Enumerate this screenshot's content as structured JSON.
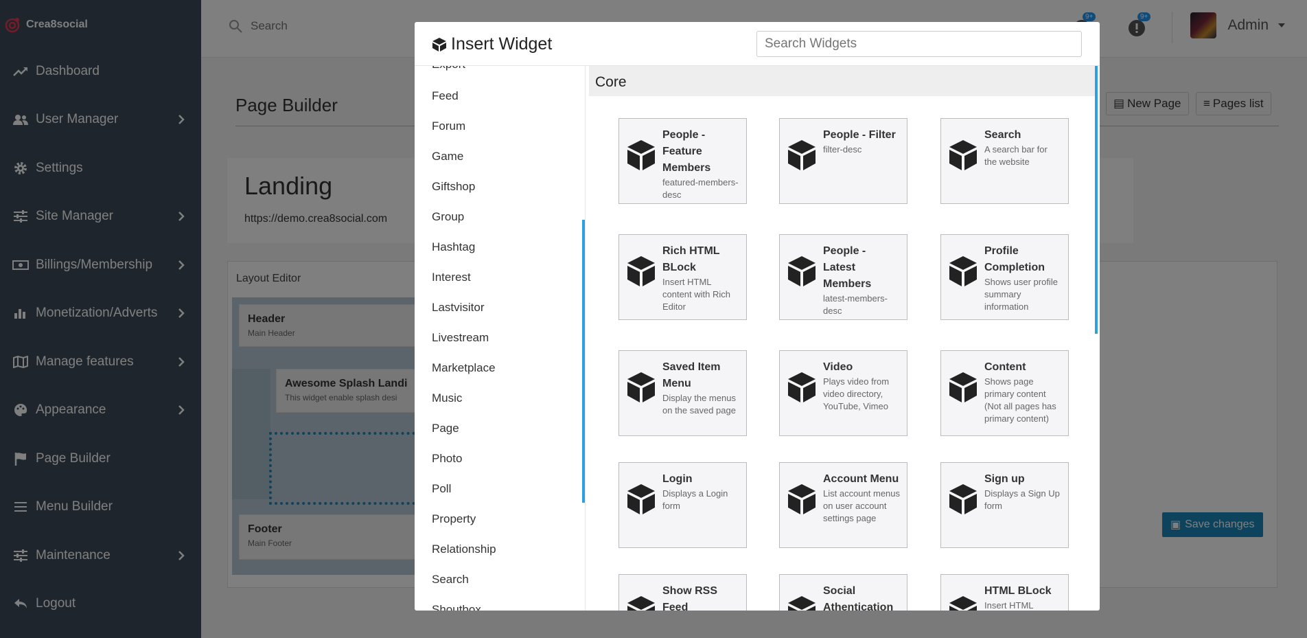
{
  "brand": {
    "name": "Crea8social"
  },
  "sidebar": {
    "items": [
      {
        "label": "Dashboard",
        "icon": "trend-icon",
        "chevron": false
      },
      {
        "label": "User Manager",
        "icon": "users-icon",
        "chevron": true
      },
      {
        "label": "Settings",
        "icon": "gear-icon",
        "chevron": false
      },
      {
        "label": "Site Manager",
        "icon": "sliders-icon",
        "chevron": true
      },
      {
        "label": "Billings/Membership",
        "icon": "money-icon",
        "chevron": true
      },
      {
        "label": "Monetization/Adverts",
        "icon": "bar-chart-icon",
        "chevron": true
      },
      {
        "label": "Manage features",
        "icon": "map-icon",
        "chevron": true
      },
      {
        "label": "Appearance",
        "icon": "palette-icon",
        "chevron": true
      },
      {
        "label": "Page Builder",
        "icon": "flag-icon",
        "chevron": false
      },
      {
        "label": "Menu Builder",
        "icon": "bars-icon",
        "chevron": false
      },
      {
        "label": "Maintenance",
        "icon": "sliders-icon",
        "chevron": true
      },
      {
        "label": "Logout",
        "icon": "reply-icon",
        "chevron": false
      }
    ]
  },
  "topbar": {
    "search_placeholder": "Search",
    "notif_badge": "9+",
    "alert_badge": "9+",
    "user": "Admin"
  },
  "page": {
    "title": "Page Builder",
    "new_page": "New Page",
    "pages_list": "Pages list",
    "landing_title": "Landing",
    "landing_url": "https://demo.crea8social.com",
    "layout_editor": "Layout Editor",
    "header_block": {
      "title": "Header",
      "sub": "Main Header"
    },
    "splash_block": {
      "title": "Awesome Splash Landi",
      "sub": "This widget enable splash desi"
    },
    "footer_block": {
      "title": "Footer",
      "sub": "Main Footer"
    },
    "save": "Save changes"
  },
  "modal": {
    "title": "Insert Widget",
    "search_placeholder": "Search Widgets",
    "categories": [
      "Export",
      "Feed",
      "Forum",
      "Game",
      "Giftshop",
      "Group",
      "Hashtag",
      "Interest",
      "Lastvisitor",
      "Livestream",
      "Marketplace",
      "Music",
      "Page",
      "Photo",
      "Poll",
      "Property",
      "Relationship",
      "Search",
      "Shoutbox"
    ],
    "section": "Core",
    "widgets": [
      {
        "title": "People - Feature Members",
        "desc": "featured-members-desc"
      },
      {
        "title": "People - Filter",
        "desc": "filter-desc"
      },
      {
        "title": "Search",
        "desc": "A search bar for the website"
      },
      {
        "title": "Rich HTML BLock",
        "desc": "Insert HTML content with Rich Editor"
      },
      {
        "title": "People - Latest Members",
        "desc": "latest-members-desc"
      },
      {
        "title": "Profile Completion",
        "desc": "Shows user profile summary information"
      },
      {
        "title": "Saved Item Menu",
        "desc": "Display the menus on the saved page"
      },
      {
        "title": "Video",
        "desc": "Plays video from video directory, YouTube, Vimeo"
      },
      {
        "title": "Content",
        "desc": "Shows page primary content (Not all pages has primary content)"
      },
      {
        "title": "Login",
        "desc": "Displays a Login form"
      },
      {
        "title": "Account Menu",
        "desc": "List account menus on user account settings page"
      },
      {
        "title": "Sign up",
        "desc": "Displays a Sign Up form"
      },
      {
        "title": "Show RSS Feed",
        "desc": ""
      },
      {
        "title": "Social Athentication",
        "desc": ""
      },
      {
        "title": "HTML BLock",
        "desc": "Insert HTML"
      }
    ]
  },
  "colors": {
    "sidebar": "#3d4b58",
    "accent": "#2da0e0",
    "save": "#1a86b8"
  }
}
